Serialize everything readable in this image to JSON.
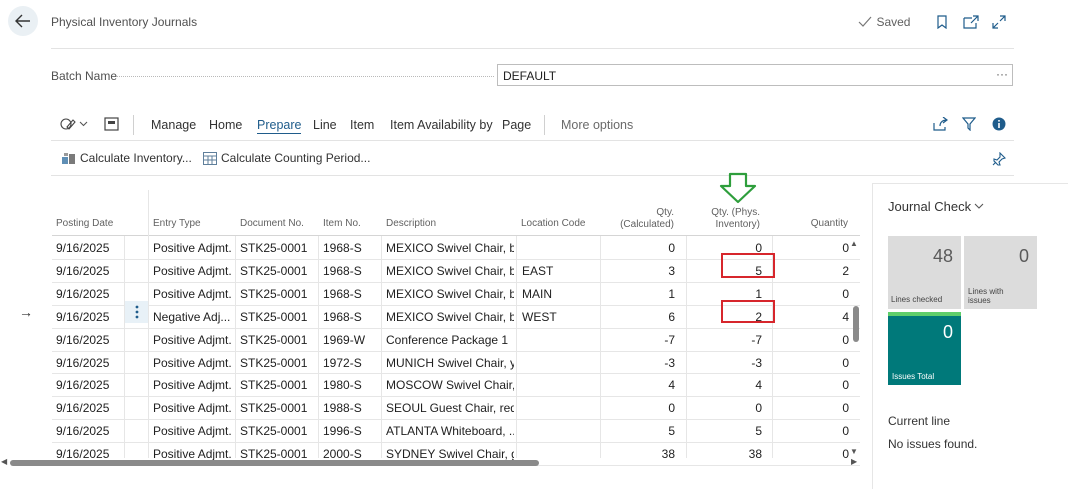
{
  "header": {
    "title": "Physical Inventory Journals",
    "saved": "Saved"
  },
  "batch": {
    "label": "Batch Name",
    "value": "DEFAULT",
    "more": "···"
  },
  "menu": {
    "items": [
      "Manage",
      "Home",
      "Prepare",
      "Line",
      "Item",
      "Item Availability by",
      "Page"
    ],
    "more_options": "More options",
    "active": "Prepare"
  },
  "sub_actions": {
    "calculate_inventory": "Calculate Inventory...",
    "calculate_counting_period": "Calculate Counting Period..."
  },
  "grid": {
    "headers": {
      "posting_date": "Posting Date",
      "entry_type": "Entry Type",
      "document_no": "Document No.",
      "item_no": "Item No.",
      "description": "Description",
      "location_code": "Location Code",
      "qty_calc_1": "Qty.",
      "qty_calc_2": "(Calculated)",
      "qty_phys_1": "Qty. (Phys.",
      "qty_phys_2": "Inventory)",
      "quantity": "Quantity"
    },
    "rows": [
      {
        "date": "9/16/2025",
        "type": "Positive Adjmt.",
        "doc": "STK25-0001",
        "item": "1968-S",
        "desc": "MEXICO Swivel Chair, bl...",
        "loc": "",
        "calc": "0",
        "phys": "0",
        "qty": "0"
      },
      {
        "date": "9/16/2025",
        "type": "Positive Adjmt.",
        "doc": "STK25-0001",
        "item": "1968-S",
        "desc": "MEXICO Swivel Chair, bl...",
        "loc": "EAST",
        "calc": "3",
        "phys": "5",
        "qty": "2"
      },
      {
        "date": "9/16/2025",
        "type": "Positive Adjmt.",
        "doc": "STK25-0001",
        "item": "1968-S",
        "desc": "MEXICO Swivel Chair, bl...",
        "loc": "MAIN",
        "calc": "1",
        "phys": "1",
        "qty": "0"
      },
      {
        "date": "9/16/2025",
        "type": "Negative Adj...",
        "doc": "STK25-0001",
        "item": "1968-S",
        "desc": "MEXICO Swivel Chair, bl...",
        "loc": "WEST",
        "calc": "6",
        "phys": "2",
        "qty": "4"
      },
      {
        "date": "9/16/2025",
        "type": "Positive Adjmt.",
        "doc": "STK25-0001",
        "item": "1969-W",
        "desc": "Conference Package 1",
        "loc": "",
        "calc": "-7",
        "phys": "-7",
        "qty": "0"
      },
      {
        "date": "9/16/2025",
        "type": "Positive Adjmt.",
        "doc": "STK25-0001",
        "item": "1972-S",
        "desc": "MUNICH Swivel Chair, y...",
        "loc": "",
        "calc": "-3",
        "phys": "-3",
        "qty": "0"
      },
      {
        "date": "9/16/2025",
        "type": "Positive Adjmt.",
        "doc": "STK25-0001",
        "item": "1980-S",
        "desc": "MOSCOW Swivel Chair, ...",
        "loc": "",
        "calc": "4",
        "phys": "4",
        "qty": "0"
      },
      {
        "date": "9/16/2025",
        "type": "Positive Adjmt.",
        "doc": "STK25-0001",
        "item": "1988-S",
        "desc": "SEOUL Guest Chair, red",
        "loc": "",
        "calc": "0",
        "phys": "0",
        "qty": "0"
      },
      {
        "date": "9/16/2025",
        "type": "Positive Adjmt.",
        "doc": "STK25-0001",
        "item": "1996-S",
        "desc": "ATLANTA Whiteboard, ...",
        "loc": "",
        "calc": "5",
        "phys": "5",
        "qty": "0"
      },
      {
        "date": "9/16/2025",
        "type": "Positive Adjmt.",
        "doc": "STK25-0001",
        "item": "2000-S",
        "desc": "SYDNEY Swivel Chair, gr...",
        "loc": "",
        "calc": "38",
        "phys": "38",
        "qty": "0"
      }
    ]
  },
  "journal_check": {
    "title": "Journal Check",
    "lines_checked_value": "48",
    "lines_checked_label": "Lines checked",
    "lines_issues_value": "0",
    "lines_issues_label_1": "Lines with",
    "lines_issues_label_2": "issues",
    "issues_total_value": "0",
    "issues_total_label": "Issues Total",
    "current_line_title": "Current line",
    "current_line_text": "No issues found."
  },
  "colors": {
    "accent": "#1f5c8b",
    "teal": "#00797a",
    "tile_gray": "#dcdcdc",
    "red_highlight": "#d7262c",
    "green_arrow": "#2e9e3c"
  }
}
